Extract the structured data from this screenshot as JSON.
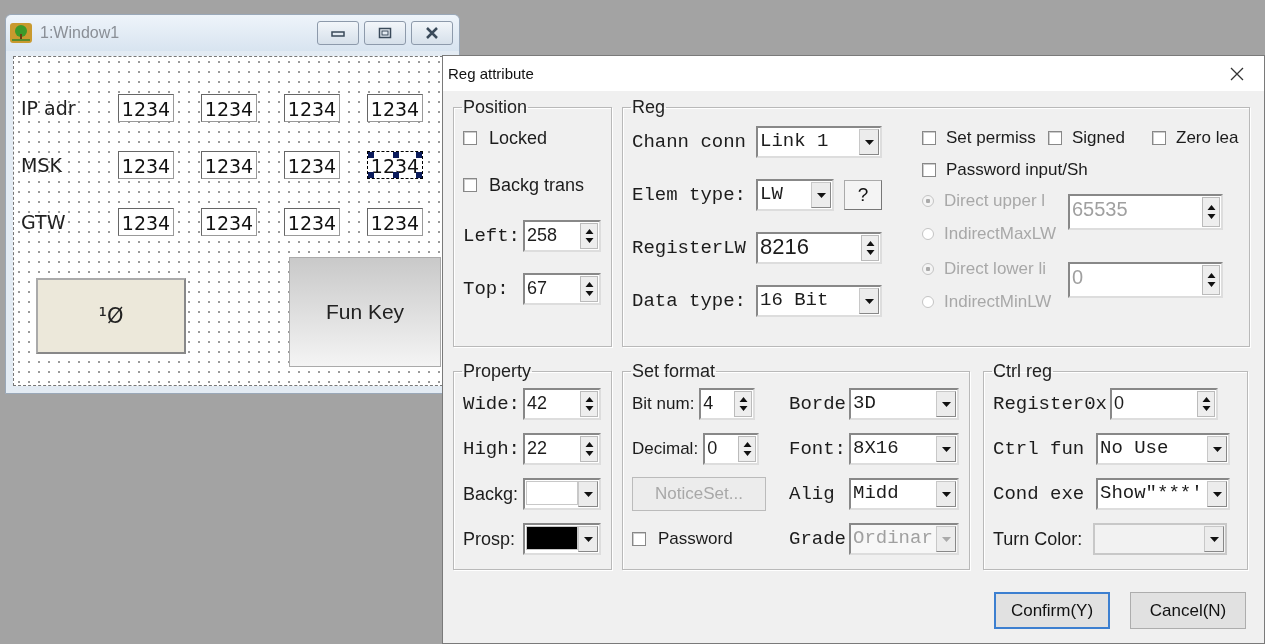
{
  "window": {
    "title": "1:Window1",
    "rows": [
      {
        "label": "IP adr",
        "fields": [
          {
            "value": "1234",
            "selected": false
          },
          {
            "value": "1234",
            "selected": false
          },
          {
            "value": "1234",
            "selected": false
          },
          {
            "value": "1234",
            "selected": false
          }
        ]
      },
      {
        "label": "MSK",
        "fields": [
          {
            "value": "1234",
            "selected": false
          },
          {
            "value": "1234",
            "selected": false
          },
          {
            "value": "1234",
            "selected": false
          },
          {
            "value": "1234",
            "selected": true
          }
        ]
      },
      {
        "label": "GTW",
        "fields": [
          {
            "value": "1234",
            "selected": false
          },
          {
            "value": "1234",
            "selected": false
          },
          {
            "value": "1234",
            "selected": false
          },
          {
            "value": "1234",
            "selected": false
          }
        ]
      }
    ],
    "keys": [
      {
        "label": "¹Ø",
        "kind": "bit"
      },
      {
        "label": "Fun Key",
        "kind": "function"
      }
    ]
  },
  "dialog": {
    "title": "Reg attribute",
    "position": {
      "title": "Position",
      "checkboxes": [
        {
          "label": "Locked",
          "checked": false
        },
        {
          "label": "Backg trans",
          "checked": false
        }
      ],
      "spins": [
        {
          "label": "Left:",
          "value": "258"
        },
        {
          "label": "Top:",
          "value": "67"
        }
      ]
    },
    "reg": {
      "title": "Reg",
      "fields": [
        {
          "label": "Chann conn",
          "kind": "combo",
          "value": "Link 1"
        },
        {
          "label": "Elem type:",
          "kind": "combo",
          "value": "LW",
          "help": "?"
        },
        {
          "label": "RegisterLW",
          "kind": "spin",
          "value": "8216"
        },
        {
          "label": "Data type:",
          "kind": "combo",
          "value": "16 Bit"
        }
      ],
      "options": [
        {
          "label": "Set permiss",
          "checked": false
        },
        {
          "label": "Signed",
          "checked": false
        },
        {
          "label": "Zero lea",
          "checked": false
        },
        {
          "label": "Password input/Sh",
          "checked": false
        }
      ],
      "limits": [
        {
          "disabled": true,
          "value": "65535",
          "radios": [
            {
              "label": "Direct upper l",
              "selected": true
            },
            {
              "label": "IndirectMaxLW",
              "selected": false
            }
          ]
        },
        {
          "disabled": true,
          "value": "0",
          "radios": [
            {
              "label": "Direct lower li",
              "selected": true
            },
            {
              "label": "IndirectMinLW",
              "selected": false
            }
          ]
        }
      ]
    },
    "property": {
      "title": "Property",
      "spins": [
        {
          "label": "Wide:",
          "value": "42"
        },
        {
          "label": "High:",
          "value": "22"
        }
      ],
      "colors": [
        {
          "label": "Backg:",
          "color": "#ffffff"
        },
        {
          "label": "Prosp:",
          "color": "#000000"
        }
      ]
    },
    "set_format": {
      "title": "Set format",
      "spins": [
        {
          "label": "Bit num:",
          "value": "4"
        },
        {
          "label": "Decimal:",
          "value": "0"
        }
      ],
      "notice_button": {
        "label": "NoticeSet...",
        "disabled": true
      },
      "password": {
        "label": "Password",
        "checked": false
      },
      "combos": [
        {
          "label": "Borde",
          "value": "3D",
          "disabled": false
        },
        {
          "label": "Font:",
          "value": "8X16",
          "disabled": false
        },
        {
          "label": "Alig",
          "value": "Midd",
          "disabled": false
        },
        {
          "label": "Grade",
          "value": "Ordinar",
          "disabled": true
        }
      ]
    },
    "ctrl_reg": {
      "title": "Ctrl reg",
      "spin": {
        "label": "Register0x",
        "value": "0"
      },
      "combos": [
        {
          "label": "Ctrl fun",
          "value": "No Use"
        },
        {
          "label": "Cond exe",
          "value": "Show\"***'"
        }
      ],
      "turn_color": {
        "label": "Turn Color:",
        "disabled": true
      }
    },
    "buttons": [
      {
        "label": "Confirm(Y)",
        "default": true
      },
      {
        "label": "Cancel(N)",
        "default": false
      }
    ]
  }
}
